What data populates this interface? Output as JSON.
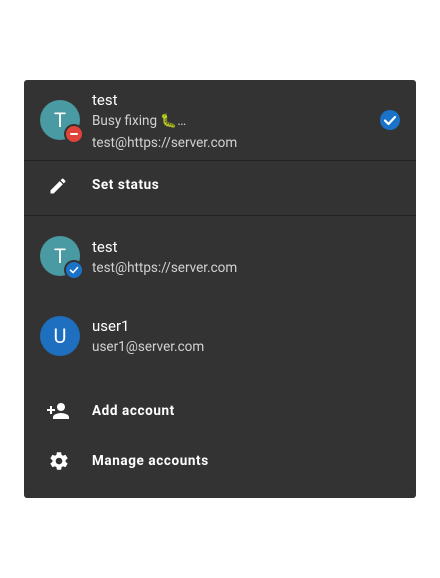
{
  "current_account": {
    "avatar_letter": "T",
    "name": "test",
    "status": "Busy fixing 🐛…",
    "email": "test@https://server.com",
    "status_badge_icon": "do-not-disturb-icon",
    "selected_icon": "check-circle-icon"
  },
  "set_status": {
    "label": "Set status",
    "icon": "pencil-icon"
  },
  "accounts": [
    {
      "avatar_letter": "T",
      "name": "test",
      "email": "test@https://server.com",
      "badge_icon": "check-circle-icon"
    },
    {
      "avatar_letter": "U",
      "name": "user1",
      "email": "user1@server.com"
    }
  ],
  "menu": {
    "add_account": {
      "label": "Add account",
      "icon": "person-add-icon"
    },
    "manage_accounts": {
      "label": "Manage accounts",
      "icon": "gear-icon"
    }
  },
  "colors": {
    "panel_bg": "#333333",
    "avatar_teal": "#4a9aa3",
    "avatar_blue": "#1e6fc0",
    "dnd_red": "#e0433a",
    "check_blue": "#1a73c8"
  }
}
